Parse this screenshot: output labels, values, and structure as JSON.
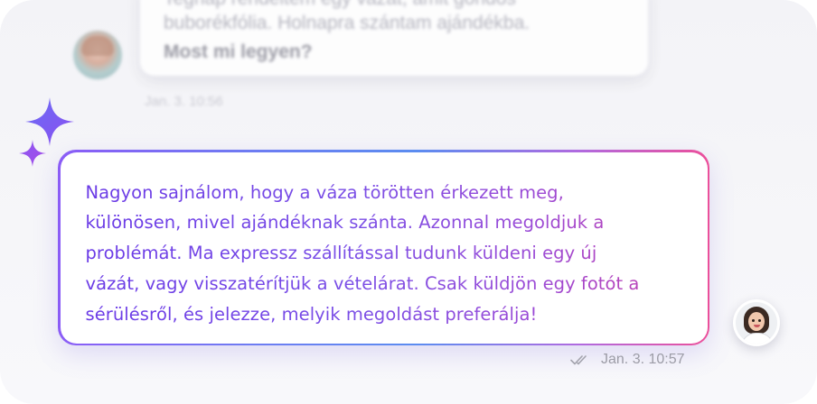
{
  "previous_message": {
    "lines": [
      "Tegnap rendeltem egy vázát, amit gondos",
      "buborékfólia. Holnapra szántam ajándékba.",
      "Most mi legyen?"
    ],
    "timestamp": "Jan. 3. 10:56"
  },
  "reply": {
    "lines": [
      "Nagyon sajnálom, hogy a váza törötten érkezett meg,",
      "különösen, mivel ajándéknak szánta. Azonnal megoldjuk a",
      "problémát. Ma expressz szállítással tudunk küldeni egy új",
      "vázát, vagy visszatérítjük a vételárat. Csak küldjön egy fotót a",
      "sérülésről, és jelezze, melyik megoldást preferálja!"
    ],
    "timestamp": "Jan. 3. 10:57",
    "status_icon": "double-check-icon"
  },
  "colors": {
    "gradient_start": "#8b5cf6",
    "gradient_mid": "#5b8cf0",
    "gradient_end": "#ec4f9a",
    "sparkle": "#7c5cf0"
  }
}
